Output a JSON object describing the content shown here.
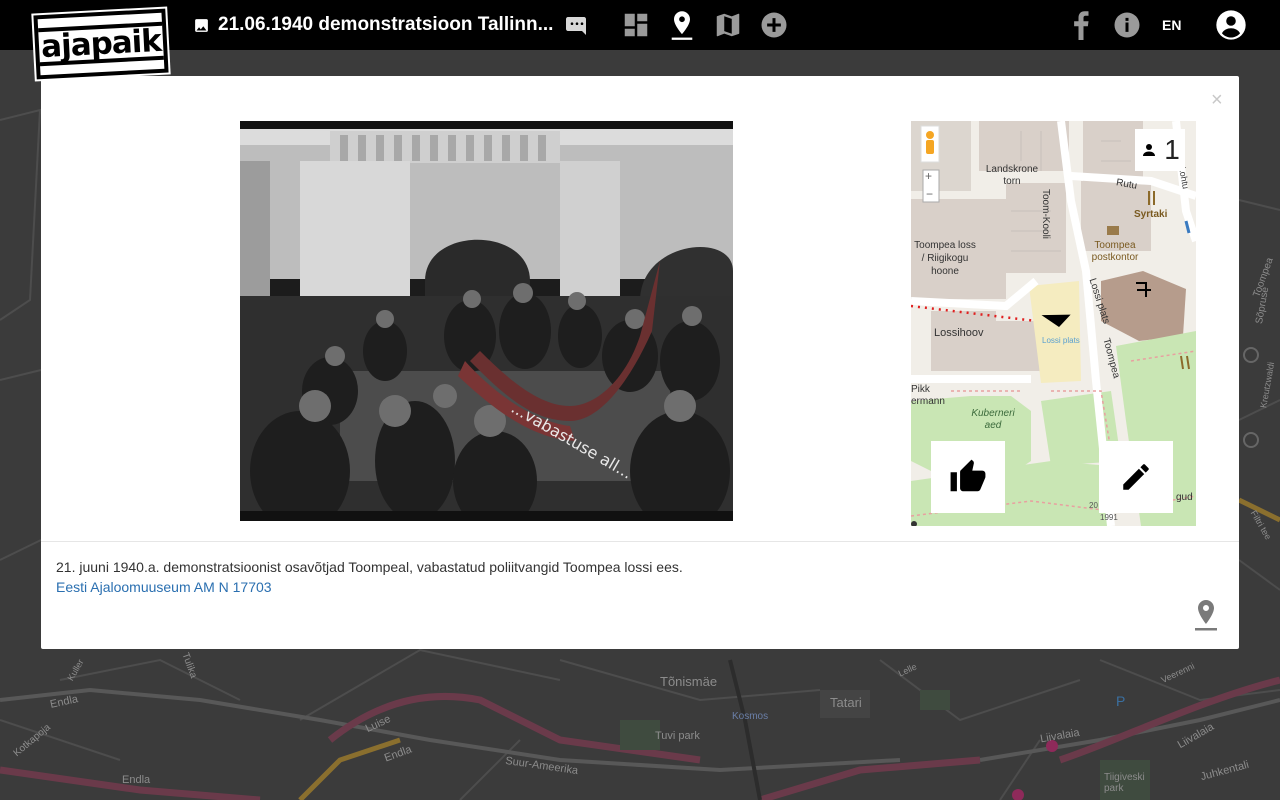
{
  "header": {
    "logo_text": "ajapaik",
    "photo_title": "21.06.1940 demonstratsioon Tallinn...",
    "language": "EN"
  },
  "modal": {
    "close_label": "×",
    "caption": "21. juuni 1940.a. demonstratsioonist osavõtjad Toompeal, vabastatud poliitvangid Toompea lossi ees.",
    "source": "Eesti Ajaloomuuseum AM N 17703",
    "photo_banner_text": "...vabastuse all..."
  },
  "minimap": {
    "rephoto_count": "1",
    "zoom_in": "+",
    "zoom_out": "−",
    "labels": {
      "landskrone": "Landskrone torn",
      "toom_kooli": "Toom-Kooli",
      "rutu": "Rutu",
      "kohtu": "kohtu",
      "syrtaki": "Syrtaki",
      "toompea_loss": "Toompea loss / Riigikogu hoone",
      "toompea_postkontor": "Toompea postkontor",
      "lossi_plats_street": "Lossi plats",
      "lossi_plats_square": "Lossi plats",
      "lossihoov": "Lossihoov",
      "toompea": "Toompea",
      "pikk_hermann": "Pikk ermann",
      "kuberneri_aed": "Kuberneri aed",
      "gud": "gud",
      "year_label": "1991",
      "num_20": "20"
    }
  },
  "background_map_labels": [
    "Tõnismäe",
    "Tatari",
    "Endla",
    "Endla",
    "Endla",
    "Suur-Ameerika",
    "Luise",
    "Tuvi park",
    "Juhkentali",
    "Tiigiveski park",
    "Liivalaia",
    "Liivalaia",
    "Kosmos",
    "Toompea",
    "Tulika",
    "Kotkapoja",
    "Sõpruse",
    "Kuller",
    "Lelle",
    "Veerenni",
    "Filtri tee",
    "Kreutzwaldi"
  ],
  "colors": {
    "topbar": "#000000",
    "link": "#2a6fb0",
    "map_green": "#c8e6b5",
    "map_building": "#d8d0c8",
    "map_road": "#ffffff",
    "path_red": "#e02020"
  }
}
